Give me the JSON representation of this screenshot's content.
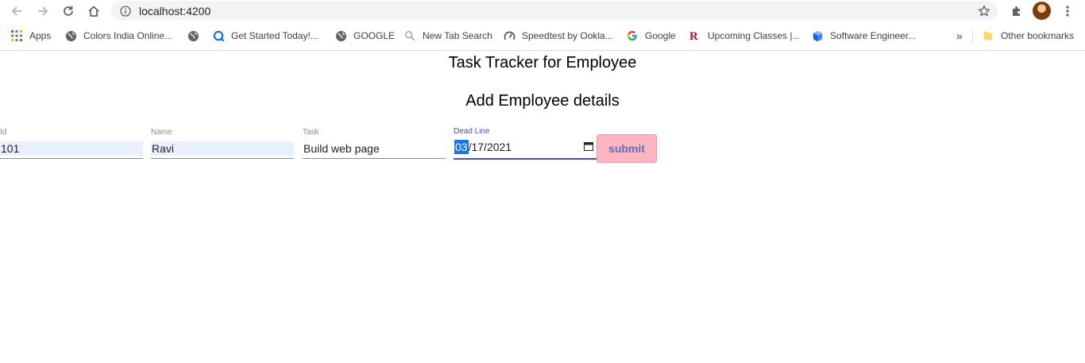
{
  "browser": {
    "url": "localhost:4200",
    "bookmarks": [
      {
        "label": "Apps",
        "icon": "apps-grid-icon"
      },
      {
        "label": "Colors India Online...",
        "icon": "globe-icon"
      },
      {
        "label": "",
        "icon": "globe-icon"
      },
      {
        "label": "Get Started Today!...",
        "icon": "q-logo-icon"
      },
      {
        "label": "GOOGLE",
        "icon": "globe-icon"
      },
      {
        "label": "New Tab Search",
        "icon": "search-icon"
      },
      {
        "label": "Speedtest by Ookla...",
        "icon": "speedometer-icon"
      },
      {
        "label": "Google",
        "icon": "google-g-icon"
      },
      {
        "label": "Upcoming Classes |...",
        "icon": "rutgers-r-icon"
      },
      {
        "label": "Software Engineer...",
        "icon": "cube-icon"
      }
    ],
    "overflow_label": "»",
    "other_bookmarks": "Other bookmarks"
  },
  "page": {
    "title": "Task Tracker for Employee",
    "subtitle": "Add Employee details"
  },
  "form": {
    "id": {
      "label": "Id",
      "value": "101"
    },
    "name": {
      "label": "Name",
      "value": "Ravi"
    },
    "task": {
      "label": "Task",
      "value": "Build web page"
    },
    "deadline": {
      "label": "Dead Line",
      "month": "03",
      "day": "17",
      "year": "2021",
      "sep": "/"
    },
    "submit_label": "submit"
  },
  "colors": {
    "accent": "#3f51b5",
    "submit_bg": "#ffb6c1",
    "autofill_bg": "#e8f0fe",
    "selection": "#1a73e8"
  }
}
